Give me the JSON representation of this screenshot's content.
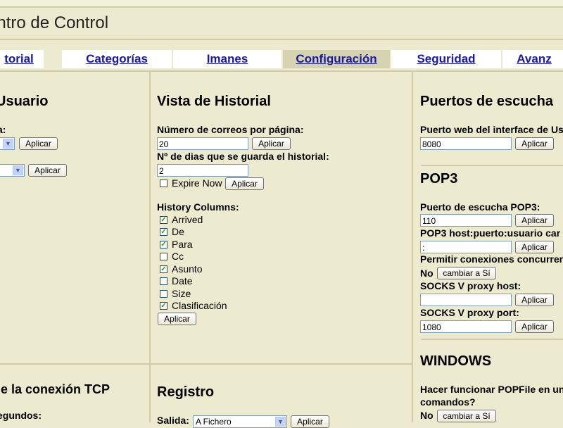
{
  "title": "entro de Control",
  "tabs": [
    {
      "label": "torial",
      "active": false
    },
    {
      "label": "Categorías",
      "active": false
    },
    {
      "label": "Imanes",
      "active": false
    },
    {
      "label": "Configuración",
      "active": true
    },
    {
      "label": "Seguridad",
      "active": false
    },
    {
      "label": "Avanz",
      "active": false
    }
  ],
  "apply_label": "Aplicar",
  "usuario": {
    "heading": "Usuario",
    "field1_label": "a:"
  },
  "historial": {
    "heading": "Vista de Historial",
    "per_page_label": "Número de correos por página:",
    "per_page_value": "20",
    "days_label": "Nº de dias que se guarda el historial:",
    "days_value": "2",
    "expire_label": "Expire Now",
    "expire_checked": false,
    "columns_label": "History Columns:",
    "columns": [
      {
        "label": "Arrived",
        "checked": true
      },
      {
        "label": "De",
        "checked": true
      },
      {
        "label": "Para",
        "checked": true
      },
      {
        "label": "Cc",
        "checked": false
      },
      {
        "label": "Asunto",
        "checked": true
      },
      {
        "label": "Date",
        "checked": false
      },
      {
        "label": "Size",
        "checked": false
      },
      {
        "label": "Clasificación",
        "checked": true
      }
    ]
  },
  "puertos": {
    "heading": "Puertos de escucha",
    "web_port_label": "Puerto web del interface de Us",
    "web_port_value": "8080"
  },
  "pop3": {
    "heading": "POP3",
    "port_label": "Puerto de escucha POP3:",
    "port_value": "110",
    "host_label": "POP3 host:puerto:usuario car",
    "host_value": ":",
    "concurrent_label": "Permitir conexiones concurrer",
    "concurrent_value": "No",
    "concurrent_button": "cambiar a Sí",
    "socks_host_label": "SOCKS V proxy host:",
    "socks_host_value": "",
    "socks_port_label": "SOCKS V proxy port:",
    "socks_port_value": "1080"
  },
  "windows": {
    "heading": "WINDOWS",
    "run_label_1": "Hacer funcionar POPFile en un",
    "run_label_2": "comandos?",
    "run_value": "No",
    "run_button": "cambiar a Sí"
  },
  "tcp": {
    "heading": "le la conexión TCP",
    "seconds_label": "egundos:"
  },
  "registro": {
    "heading": "Registro",
    "output_label": "Salida:",
    "output_value": "A Fichero"
  }
}
